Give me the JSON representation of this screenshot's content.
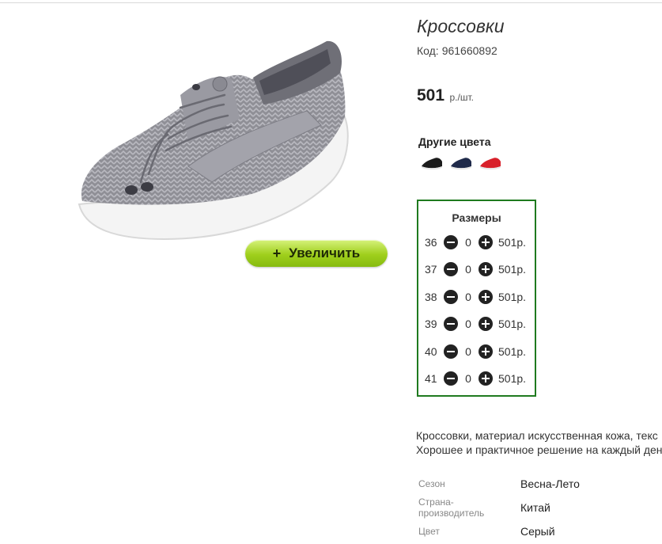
{
  "product": {
    "title": "Кроссовки",
    "code_label": "Код:",
    "code_value": "961660892",
    "price_value": "501",
    "price_unit": "р./шт.",
    "zoom_plus": "+",
    "zoom_label": "Увеличить"
  },
  "other_colors": {
    "title": "Другие цвета",
    "swatches": [
      {
        "icon": "black-sneaker",
        "color": "#1b1b1b"
      },
      {
        "icon": "navy-sneaker",
        "color": "#1f2a4a"
      },
      {
        "icon": "red-sneaker",
        "color": "#d8202a"
      }
    ]
  },
  "sizes": {
    "title": "Размеры",
    "rows": [
      {
        "size": "36",
        "qty": "0",
        "price": "501р."
      },
      {
        "size": "37",
        "qty": "0",
        "price": "501р."
      },
      {
        "size": "38",
        "qty": "0",
        "price": "501р."
      },
      {
        "size": "39",
        "qty": "0",
        "price": "501р."
      },
      {
        "size": "40",
        "qty": "0",
        "price": "501р."
      },
      {
        "size": "41",
        "qty": "0",
        "price": "501р."
      }
    ]
  },
  "description": {
    "line1": "Кроссовки, материал искусственная кожа, текс",
    "line2": "Хорошее и практичное решение на каждый ден"
  },
  "properties": [
    {
      "label": "Сезон",
      "value": "Весна-Лето"
    },
    {
      "label": "Страна-производитель",
      "value": "Китай"
    },
    {
      "label": "Цвет",
      "value": "Серый"
    }
  ],
  "colors": {
    "accent_green": "#1f7a1f",
    "button_green": "#9fcf1c"
  }
}
